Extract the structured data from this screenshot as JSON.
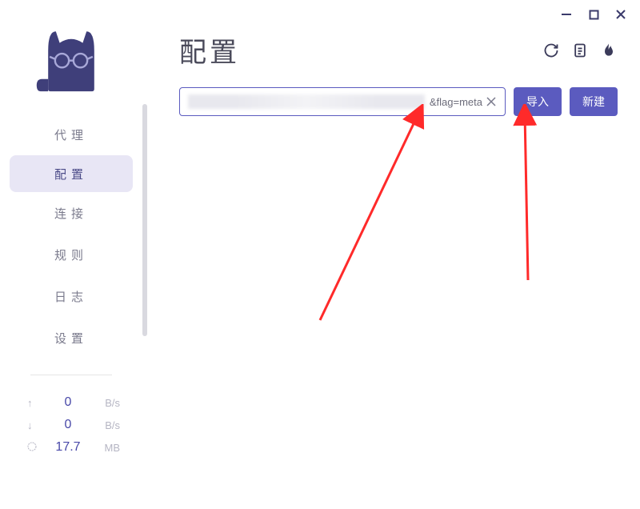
{
  "header": {
    "title": "配置"
  },
  "sidebar": {
    "items": [
      {
        "label": "代理"
      },
      {
        "label": "配置",
        "active": true
      },
      {
        "label": "连接"
      },
      {
        "label": "规则"
      },
      {
        "label": "日志"
      },
      {
        "label": "设置"
      }
    ]
  },
  "stats": {
    "upload": {
      "value": "0",
      "unit": "B/s"
    },
    "download": {
      "value": "0",
      "unit": "B/s"
    },
    "total": {
      "value": "17.7",
      "unit": "MB"
    }
  },
  "input": {
    "visible_suffix": "&flag=meta"
  },
  "buttons": {
    "import": "导入",
    "create": "新建"
  }
}
